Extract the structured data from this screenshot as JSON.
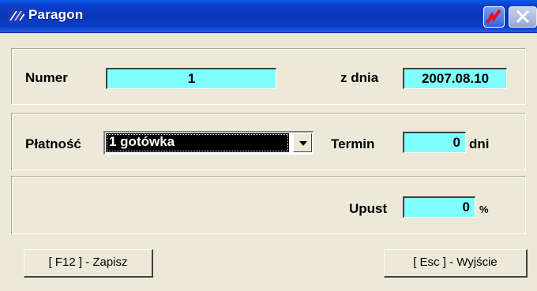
{
  "window": {
    "title": "Paragon"
  },
  "numer": {
    "label": "Numer",
    "value": "1"
  },
  "date": {
    "label": "z dnia",
    "value": "2007.08.10"
  },
  "payment": {
    "label": "Płatność",
    "value": "1 gotówka"
  },
  "term": {
    "label": "Termin",
    "value": "0",
    "unit": "dni"
  },
  "discount": {
    "label": "Upust",
    "value": "0",
    "unit": "%"
  },
  "buttons": {
    "save": "[ F12 ] - Zapisz",
    "exit": "[ Esc ] - Wyjście"
  },
  "colors": {
    "field_bg": "#80FFFF",
    "titlebar": "#0837B8",
    "window_bg": "#ECE9D8"
  }
}
